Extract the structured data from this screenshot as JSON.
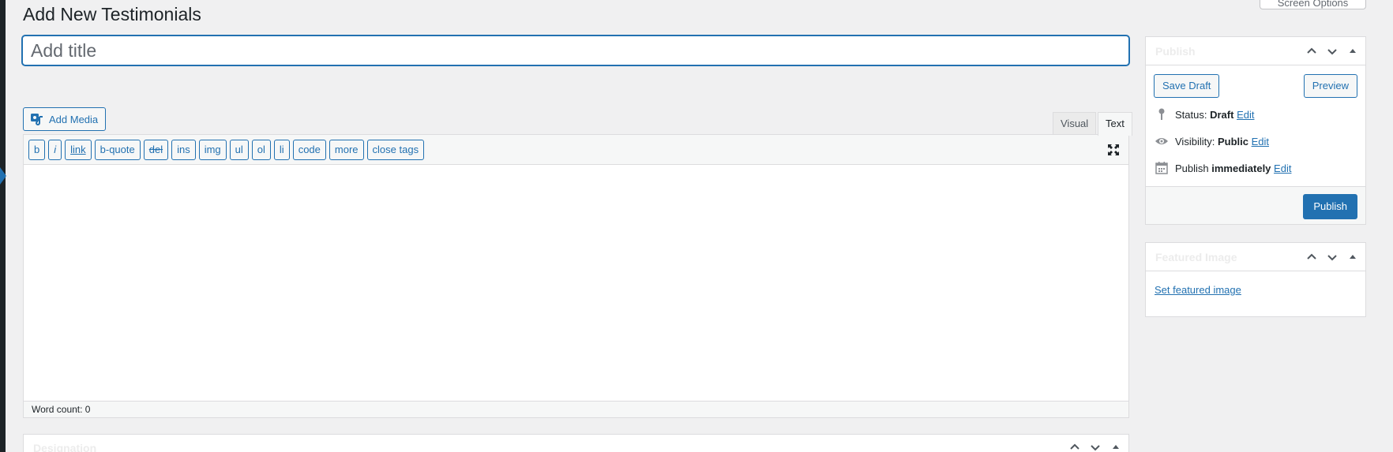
{
  "page": {
    "title": "Add New Testimonials",
    "screen_options": "Screen Options"
  },
  "title_field": {
    "value": "",
    "placeholder": "Add title"
  },
  "editor": {
    "add_media_label": "Add Media",
    "tabs": [
      {
        "label": "Visual",
        "active": false
      },
      {
        "label": "Text",
        "active": true
      }
    ],
    "quicktags": [
      "b",
      "i",
      "link",
      "b-quote",
      "del",
      "ins",
      "img",
      "ul",
      "ol",
      "li",
      "code",
      "more",
      "close tags"
    ],
    "word_count": "Word count: 0",
    "content": ""
  },
  "designation_box": {
    "title": "Designation"
  },
  "publish_box": {
    "title": "Publish",
    "save_draft": "Save Draft",
    "preview": "Preview",
    "status_label": "Status:",
    "status_value": "Draft",
    "visibility_label": "Visibility:",
    "visibility_value": "Public",
    "publish_label": "Publish",
    "publish_value": "immediately",
    "edit_link": "Edit",
    "publish_button": "Publish"
  },
  "featured_box": {
    "title": "Featured Image",
    "set_link": "Set featured image"
  },
  "colors": {
    "accent": "#2271b1",
    "background": "#f0f0f1",
    "admin_bar": "#1d2327"
  }
}
